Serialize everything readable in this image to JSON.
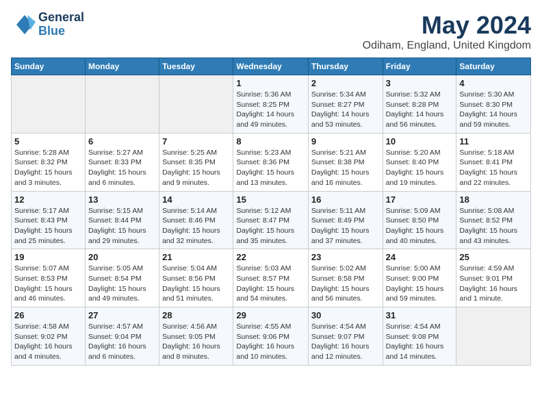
{
  "header": {
    "logo_line1": "General",
    "logo_line2": "Blue",
    "title": "May 2024",
    "subtitle": "Odiham, England, United Kingdom"
  },
  "days_of_week": [
    "Sunday",
    "Monday",
    "Tuesday",
    "Wednesday",
    "Thursday",
    "Friday",
    "Saturday"
  ],
  "weeks": [
    [
      {
        "day": "",
        "info": ""
      },
      {
        "day": "",
        "info": ""
      },
      {
        "day": "",
        "info": ""
      },
      {
        "day": "1",
        "info": "Sunrise: 5:36 AM\nSunset: 8:25 PM\nDaylight: 14 hours\nand 49 minutes."
      },
      {
        "day": "2",
        "info": "Sunrise: 5:34 AM\nSunset: 8:27 PM\nDaylight: 14 hours\nand 53 minutes."
      },
      {
        "day": "3",
        "info": "Sunrise: 5:32 AM\nSunset: 8:28 PM\nDaylight: 14 hours\nand 56 minutes."
      },
      {
        "day": "4",
        "info": "Sunrise: 5:30 AM\nSunset: 8:30 PM\nDaylight: 14 hours\nand 59 minutes."
      }
    ],
    [
      {
        "day": "5",
        "info": "Sunrise: 5:28 AM\nSunset: 8:32 PM\nDaylight: 15 hours\nand 3 minutes."
      },
      {
        "day": "6",
        "info": "Sunrise: 5:27 AM\nSunset: 8:33 PM\nDaylight: 15 hours\nand 6 minutes."
      },
      {
        "day": "7",
        "info": "Sunrise: 5:25 AM\nSunset: 8:35 PM\nDaylight: 15 hours\nand 9 minutes."
      },
      {
        "day": "8",
        "info": "Sunrise: 5:23 AM\nSunset: 8:36 PM\nDaylight: 15 hours\nand 13 minutes."
      },
      {
        "day": "9",
        "info": "Sunrise: 5:21 AM\nSunset: 8:38 PM\nDaylight: 15 hours\nand 16 minutes."
      },
      {
        "day": "10",
        "info": "Sunrise: 5:20 AM\nSunset: 8:40 PM\nDaylight: 15 hours\nand 19 minutes."
      },
      {
        "day": "11",
        "info": "Sunrise: 5:18 AM\nSunset: 8:41 PM\nDaylight: 15 hours\nand 22 minutes."
      }
    ],
    [
      {
        "day": "12",
        "info": "Sunrise: 5:17 AM\nSunset: 8:43 PM\nDaylight: 15 hours\nand 25 minutes."
      },
      {
        "day": "13",
        "info": "Sunrise: 5:15 AM\nSunset: 8:44 PM\nDaylight: 15 hours\nand 29 minutes."
      },
      {
        "day": "14",
        "info": "Sunrise: 5:14 AM\nSunset: 8:46 PM\nDaylight: 15 hours\nand 32 minutes."
      },
      {
        "day": "15",
        "info": "Sunrise: 5:12 AM\nSunset: 8:47 PM\nDaylight: 15 hours\nand 35 minutes."
      },
      {
        "day": "16",
        "info": "Sunrise: 5:11 AM\nSunset: 8:49 PM\nDaylight: 15 hours\nand 37 minutes."
      },
      {
        "day": "17",
        "info": "Sunrise: 5:09 AM\nSunset: 8:50 PM\nDaylight: 15 hours\nand 40 minutes."
      },
      {
        "day": "18",
        "info": "Sunrise: 5:08 AM\nSunset: 8:52 PM\nDaylight: 15 hours\nand 43 minutes."
      }
    ],
    [
      {
        "day": "19",
        "info": "Sunrise: 5:07 AM\nSunset: 8:53 PM\nDaylight: 15 hours\nand 46 minutes."
      },
      {
        "day": "20",
        "info": "Sunrise: 5:05 AM\nSunset: 8:54 PM\nDaylight: 15 hours\nand 49 minutes."
      },
      {
        "day": "21",
        "info": "Sunrise: 5:04 AM\nSunset: 8:56 PM\nDaylight: 15 hours\nand 51 minutes."
      },
      {
        "day": "22",
        "info": "Sunrise: 5:03 AM\nSunset: 8:57 PM\nDaylight: 15 hours\nand 54 minutes."
      },
      {
        "day": "23",
        "info": "Sunrise: 5:02 AM\nSunset: 8:58 PM\nDaylight: 15 hours\nand 56 minutes."
      },
      {
        "day": "24",
        "info": "Sunrise: 5:00 AM\nSunset: 9:00 PM\nDaylight: 15 hours\nand 59 minutes."
      },
      {
        "day": "25",
        "info": "Sunrise: 4:59 AM\nSunset: 9:01 PM\nDaylight: 16 hours\nand 1 minute."
      }
    ],
    [
      {
        "day": "26",
        "info": "Sunrise: 4:58 AM\nSunset: 9:02 PM\nDaylight: 16 hours\nand 4 minutes."
      },
      {
        "day": "27",
        "info": "Sunrise: 4:57 AM\nSunset: 9:04 PM\nDaylight: 16 hours\nand 6 minutes."
      },
      {
        "day": "28",
        "info": "Sunrise: 4:56 AM\nSunset: 9:05 PM\nDaylight: 16 hours\nand 8 minutes."
      },
      {
        "day": "29",
        "info": "Sunrise: 4:55 AM\nSunset: 9:06 PM\nDaylight: 16 hours\nand 10 minutes."
      },
      {
        "day": "30",
        "info": "Sunrise: 4:54 AM\nSunset: 9:07 PM\nDaylight: 16 hours\nand 12 minutes."
      },
      {
        "day": "31",
        "info": "Sunrise: 4:54 AM\nSunset: 9:08 PM\nDaylight: 16 hours\nand 14 minutes."
      },
      {
        "day": "",
        "info": ""
      }
    ]
  ]
}
